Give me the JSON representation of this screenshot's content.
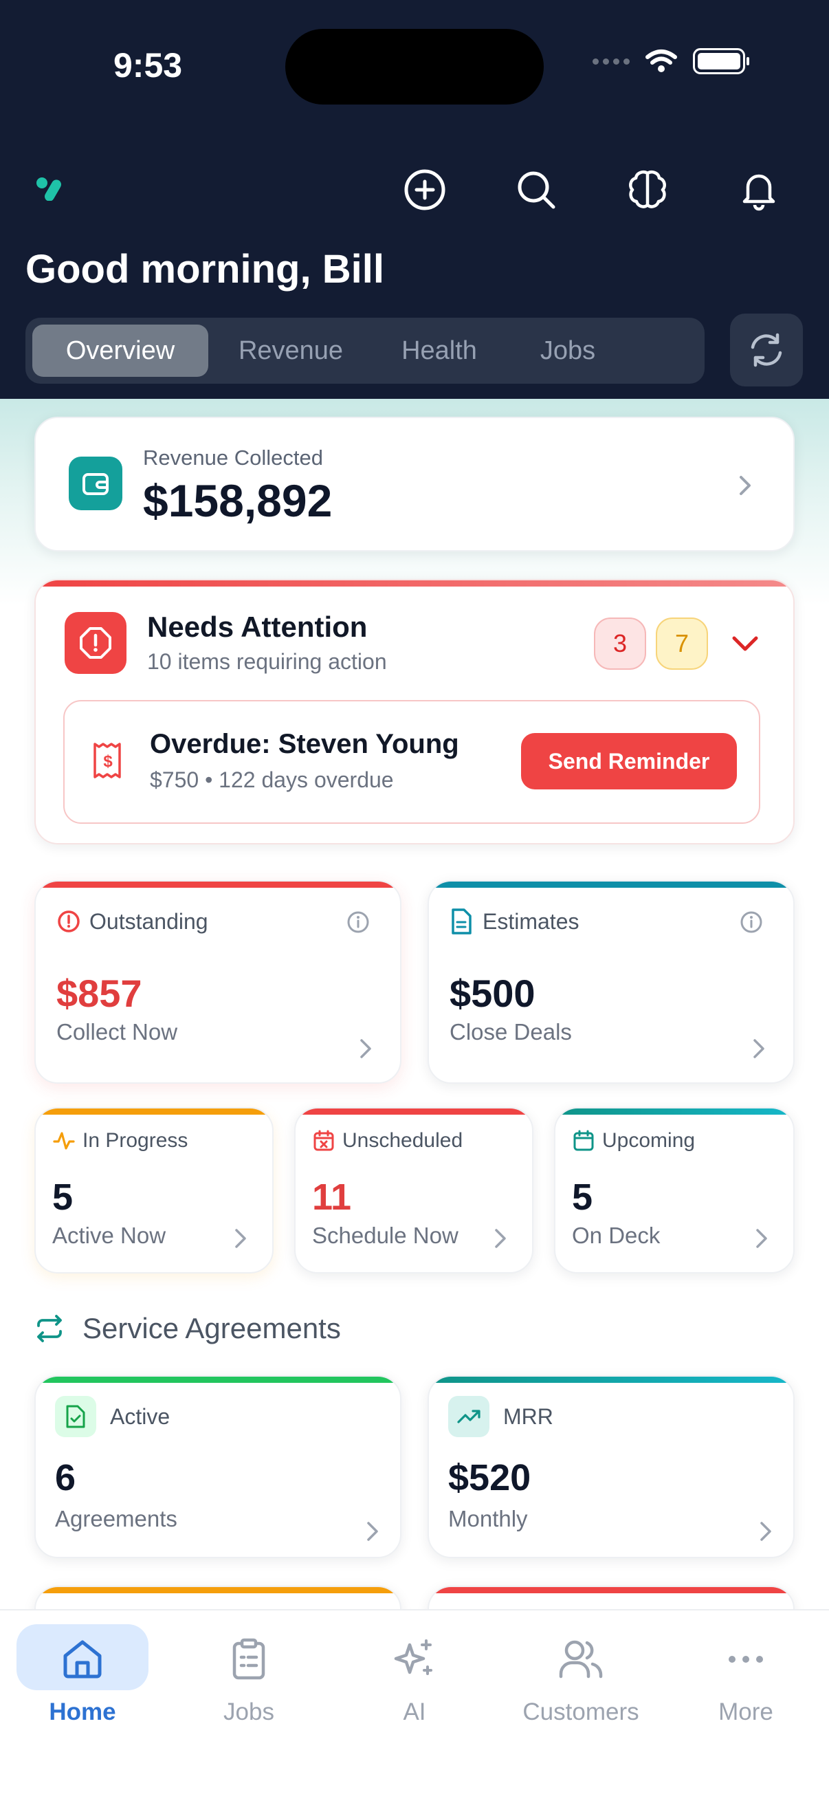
{
  "status_bar": {
    "time": "9:53"
  },
  "header": {
    "greeting": "Good morning, Bill",
    "tabs": [
      {
        "label": "Overview",
        "active": true
      },
      {
        "label": "Revenue",
        "active": false
      },
      {
        "label": "Health",
        "active": false
      },
      {
        "label": "Jobs",
        "active": false
      }
    ],
    "actions": [
      "add-icon",
      "search-icon",
      "brain-icon",
      "bell-icon",
      "refresh-icon"
    ]
  },
  "revenue": {
    "label": "Revenue Collected",
    "value": "$158,892"
  },
  "attention": {
    "title": "Needs Attention",
    "subtitle": "10 items requiring action",
    "badge_critical": "3",
    "badge_warning": "7",
    "item": {
      "title": "Overdue: Steven Young",
      "detail": "$750 • 122 days overdue",
      "action": "Send Reminder"
    }
  },
  "stats": {
    "outstanding": {
      "label": "Outstanding",
      "value": "$857",
      "sub": "Collect Now"
    },
    "estimates": {
      "label": "Estimates",
      "value": "$500",
      "sub": "Close Deals"
    },
    "in_progress": {
      "label": "In Progress",
      "value": "5",
      "sub": "Active Now"
    },
    "unscheduled": {
      "label": "Unscheduled",
      "value": "11",
      "sub": "Schedule Now"
    },
    "upcoming": {
      "label": "Upcoming",
      "value": "5",
      "sub": "On Deck"
    }
  },
  "service_agreements": {
    "title": "Service Agreements",
    "active": {
      "label": "Active",
      "value": "6",
      "sub": "Agreements"
    },
    "mrr": {
      "label": "MRR",
      "value": "$520",
      "sub": "Monthly"
    }
  },
  "nav": [
    {
      "label": "Home",
      "icon": "home-icon",
      "active": true
    },
    {
      "label": "Jobs",
      "icon": "clipboard-icon",
      "active": false
    },
    {
      "label": "AI",
      "icon": "sparkles-icon",
      "active": false
    },
    {
      "label": "Customers",
      "icon": "users-icon",
      "active": false
    },
    {
      "label": "More",
      "icon": "more-icon",
      "active": false
    }
  ],
  "colors": {
    "header_bg": "#131c33",
    "teal": "#14a09b",
    "red": "#ef4444",
    "amber": "#f59e0b",
    "green": "#22c55e",
    "blue_active": "#2d72d2"
  }
}
